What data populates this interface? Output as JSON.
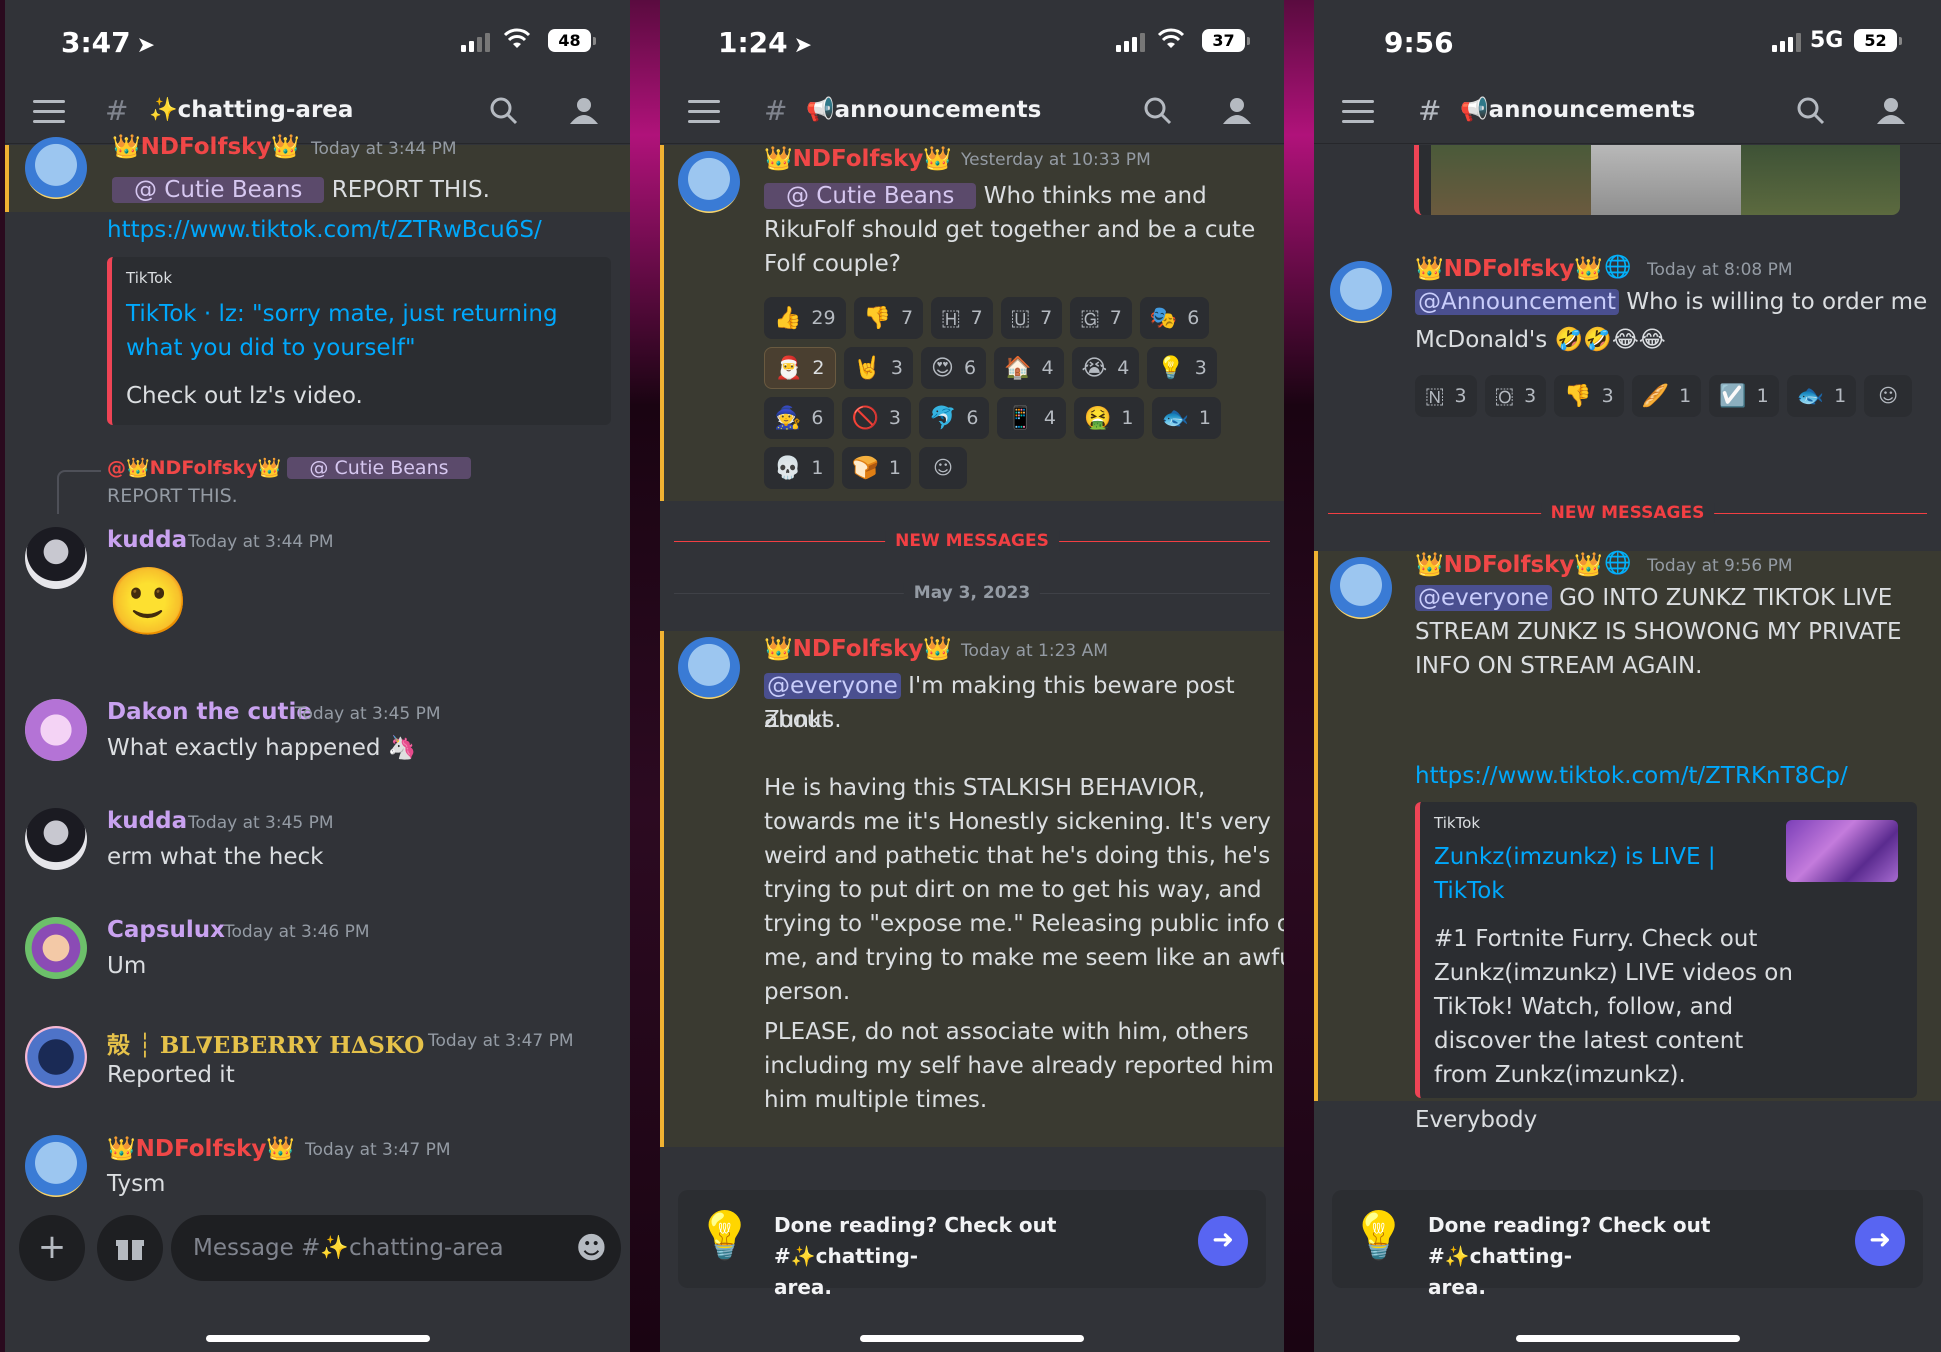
{
  "panel1": {
    "status": {
      "time": "3:47",
      "battery": "48"
    },
    "channel": {
      "name": "✨chatting-area"
    },
    "top_message": {
      "author": "👑NDFolfsky👑",
      "time": "Today at 3:44 PM",
      "mention": "@ Cutie Beans",
      "text": "REPORT THIS.",
      "link": "https://www.tiktok.com/t/ZTRwBcu6S/",
      "embed": {
        "provider": "TikTok",
        "title_line1": "TikTok · lz: \"sorry mate, just returning",
        "title_line2": "what you did to yourself\"",
        "description": "Check out lz's video."
      }
    },
    "reply_preview": {
      "author": "@👑NDFolfsky👑",
      "mention": "@ Cutie Beans",
      "text": "REPORT THIS."
    },
    "messages": [
      {
        "author": "kudda",
        "time": "Today at 3:44 PM",
        "text": "🙂"
      },
      {
        "author": "Dakon the cutie",
        "time": "Today at 3:45 PM",
        "text": "What exactly happened 🦄"
      },
      {
        "author": "kudda",
        "time": "Today at 3:45 PM",
        "text": "erm what the heck"
      },
      {
        "author": "Capsulux",
        "time": "Today at 3:46 PM",
        "text": "Um"
      },
      {
        "author": "殻 ┆ BL∇EBERRY H∆SKO",
        "time": "Today at 3:47 PM",
        "text": "Reported it"
      },
      {
        "author": "👑NDFolfsky👑",
        "time": "Today at 3:47 PM",
        "text": "Tysm"
      }
    ],
    "composer": {
      "placeholder": "Message #✨chatting-area"
    }
  },
  "panel2": {
    "status": {
      "time": "1:24",
      "battery": "37"
    },
    "channel": {
      "name": "📢announcements"
    },
    "top_message": {
      "author": "👑NDFolfsky👑",
      "time": "Yesterday at 10:33 PM",
      "mention": "@ Cutie Beans",
      "text_line1": "Who thinks me and",
      "text_line2": "RikuFolf should get together and be a cute",
      "text_line3": "Folf couple?"
    },
    "reactions": [
      {
        "emoji": "👍",
        "count": "29"
      },
      {
        "emoji": "👎",
        "count": "7"
      },
      {
        "emoji": "🇭",
        "count": "7"
      },
      {
        "emoji": "🇺",
        "count": "7"
      },
      {
        "emoji": "🇬",
        "count": "7"
      },
      {
        "emoji": "🎭",
        "count": "6"
      },
      {
        "emoji": "🎅",
        "count": "2"
      },
      {
        "emoji": "🤘",
        "count": "3"
      },
      {
        "emoji": "😍",
        "count": "6"
      },
      {
        "emoji": "🏠",
        "count": "4"
      },
      {
        "emoji": "😭",
        "count": "4"
      },
      {
        "emoji": "💡",
        "count": "3"
      },
      {
        "emoji": "🧙",
        "count": "6"
      },
      {
        "emoji": "🚫",
        "count": "3"
      },
      {
        "emoji": "🐬",
        "count": "6"
      },
      {
        "emoji": "📱",
        "count": "4"
      },
      {
        "emoji": "🤮",
        "count": "1"
      },
      {
        "emoji": "🐟",
        "count": "1"
      },
      {
        "emoji": "💀",
        "count": "1"
      },
      {
        "emoji": "🍞",
        "count": "1"
      }
    ],
    "new_messages_label": "NEW MESSAGES",
    "date_separator": "May 3, 2023",
    "second_message": {
      "author": "👑NDFolfsky👑",
      "time": "Today at 1:23 AM",
      "mention": "@everyone",
      "p1_line1": "I'm making this beware post about",
      "p1_line2": "Zunks.",
      "p2": [
        "He is having this STALKISH BEHAVIOR,",
        "towards me it's Honestly sickening. It's very",
        "weird and pathetic that he's doing this, he's",
        "trying to put dirt on me to get his way, and",
        "trying to \"expose me.\" Releasing public info on",
        "me, and trying to make me seem like an awful",
        "person."
      ],
      "p3": [
        "PLEASE, do not associate with him, others",
        "including my self have already reported him",
        "him multiple times."
      ]
    },
    "done_card": {
      "line1": "Done reading? Check out #✨chatting-",
      "line2": "area."
    }
  },
  "panel3": {
    "status": {
      "time": "9:56",
      "network": "5G",
      "battery": "52"
    },
    "channel": {
      "name": "📢announcements"
    },
    "first_message": {
      "author": "👑NDFolfsky👑",
      "time": "Today at 8:08 PM",
      "mention": "@Announcement",
      "text_line1": "Who is willing to order me",
      "text_line2": "McDonald's 🤣🤣😂😂"
    },
    "reactions": [
      {
        "emoji": "🇳",
        "count": "3"
      },
      {
        "emoji": "🇴",
        "count": "3"
      },
      {
        "emoji": "👎",
        "count": "3"
      },
      {
        "emoji": "🥖",
        "count": "1"
      },
      {
        "emoji": "☑️",
        "count": "1"
      },
      {
        "emoji": "🐟",
        "count": "1"
      }
    ],
    "new_messages_label": "NEW MESSAGES",
    "second_message": {
      "author": "👑NDFolfsky👑",
      "time": "Today at 9:56 PM",
      "mention": "@everyone",
      "text_line1": "GO INTO ZUNKZ TIKTOK LIVE",
      "text_line2": "STREAM ZUNKZ IS SHOWONG MY PRIVATE",
      "text_line3": "INFO ON STREAM AGAIN.",
      "link": "https://www.tiktok.com/t/ZTRKnT8Cp/",
      "embed": {
        "provider": "TikTok",
        "title_line1": "Zunkz(imzunkz) is LIVE |",
        "title_line2": "TikTok",
        "desc": [
          "#1 Fortnite Furry. Check out",
          "Zunkz(imzunkz) LIVE videos on",
          "TikTok! Watch, follow, and",
          "discover the latest content",
          "from Zunkz(imzunkz)."
        ]
      },
      "followup": "Everybody"
    },
    "done_card": {
      "line1": "Done reading? Check out #✨chatting-",
      "line2": "area."
    }
  },
  "colors": {
    "username_red": "#f04747",
    "username_purple": "#c9a2f0",
    "username_gold": "#e6c24a",
    "accent": "#5865f2",
    "link": "#00a8fc"
  }
}
